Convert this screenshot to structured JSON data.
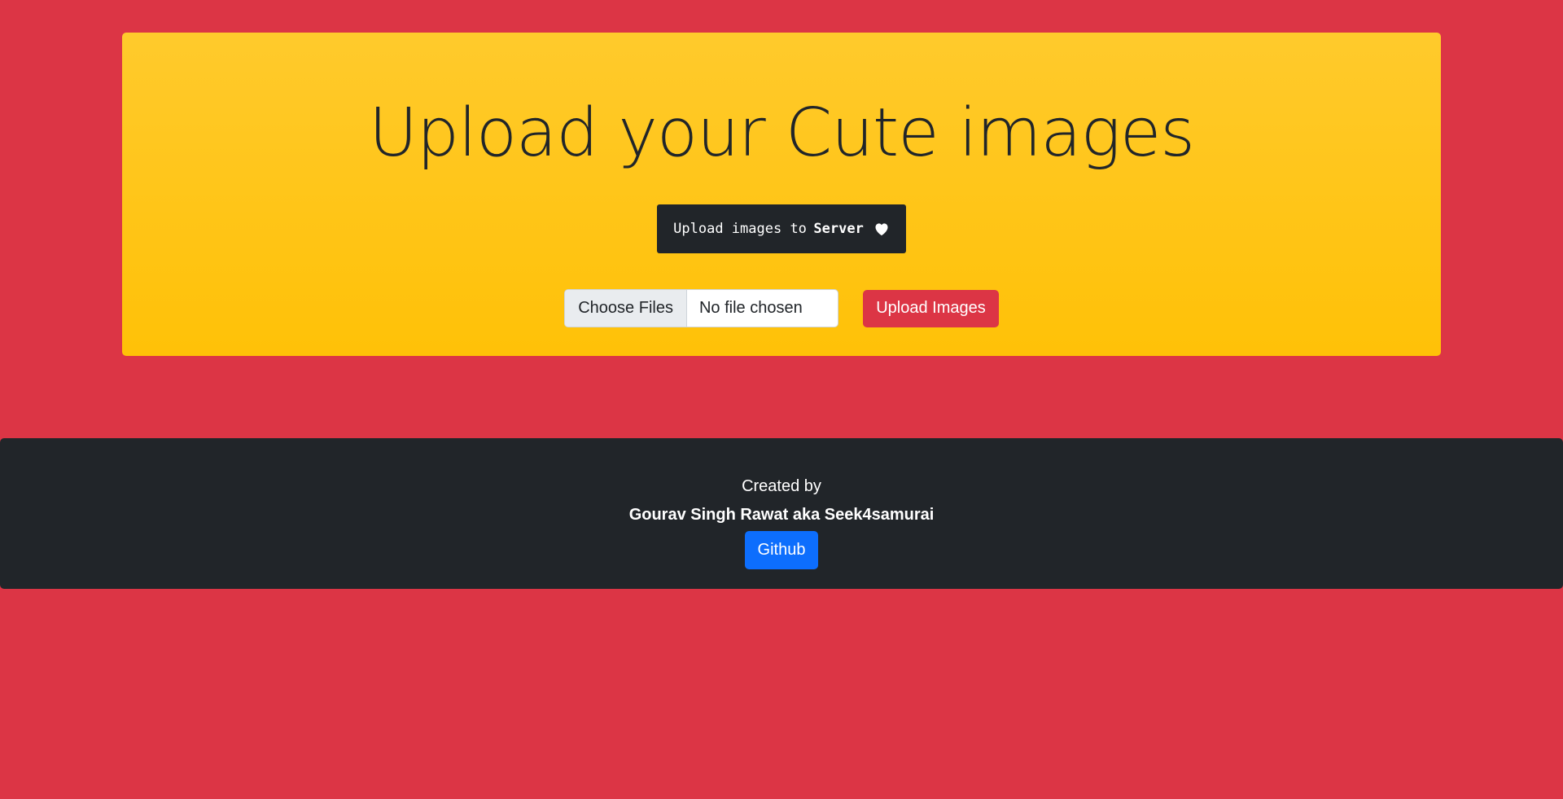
{
  "hero": {
    "title": "Upload your Cute images",
    "badge": {
      "prefix": "Upload images to",
      "strong": "Server",
      "icon": "heart-icon"
    }
  },
  "upload": {
    "choose_label": "Choose Files",
    "file_status": "No file chosen",
    "submit_label": "Upload Images"
  },
  "footer": {
    "created_label": "Created by",
    "author": "Gourav Singh Rawat aka Seek4samurai",
    "github_label": "Github"
  },
  "colors": {
    "page_bg": "#dc3545",
    "hero_bg": "#ffc107",
    "dark": "#212529",
    "primary": "#0d6efd",
    "danger": "#dc3545"
  }
}
